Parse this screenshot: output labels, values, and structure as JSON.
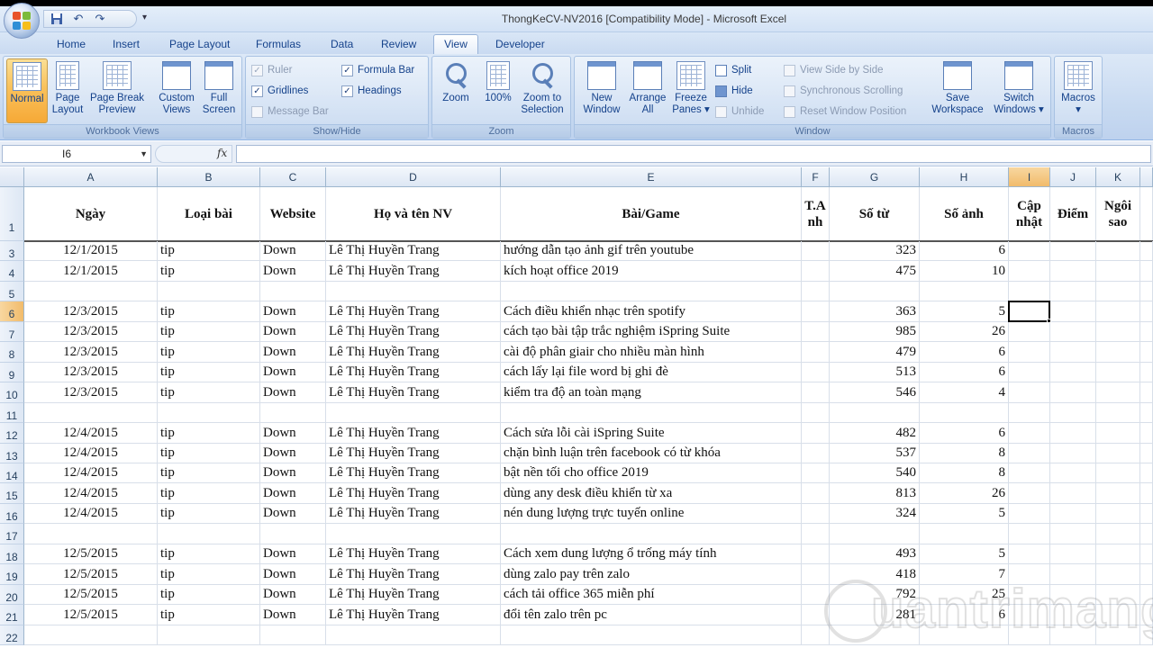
{
  "window": {
    "title": "ThongKeCV-NV2016  [Compatibility Mode] - Microsoft Excel"
  },
  "ribbon_tabs": [
    {
      "label": "Home",
      "active": false
    },
    {
      "label": "Insert",
      "active": false
    },
    {
      "label": "Page Layout",
      "active": false
    },
    {
      "label": "Formulas",
      "active": false
    },
    {
      "label": "Data",
      "active": false
    },
    {
      "label": "Review",
      "active": false
    },
    {
      "label": "View",
      "active": true
    },
    {
      "label": "Developer",
      "active": false
    }
  ],
  "ribbon": {
    "workbook_views": {
      "label": "Workbook Views",
      "normal": "Normal",
      "page_layout_1": "Page",
      "page_layout_2": "Layout",
      "page_break_1": "Page Break",
      "page_break_2": "Preview",
      "custom_views_1": "Custom",
      "custom_views_2": "Views",
      "full_screen_1": "Full",
      "full_screen_2": "Screen"
    },
    "show_hide": {
      "label": "Show/Hide",
      "ruler": "Ruler",
      "formula_bar": "Formula Bar",
      "gridlines": "Gridlines",
      "headings": "Headings",
      "message_bar": "Message Bar"
    },
    "zoom": {
      "label": "Zoom",
      "zoom": "Zoom",
      "hundred": "100%",
      "zoom_selection_1": "Zoom to",
      "zoom_selection_2": "Selection"
    },
    "window": {
      "label": "Window",
      "new_window_1": "New",
      "new_window_2": "Window",
      "arrange_all_1": "Arrange",
      "arrange_all_2": "All",
      "freeze_panes_1": "Freeze",
      "freeze_panes_2": "Panes ▾",
      "split": "Split",
      "hide": "Hide",
      "unhide": "Unhide",
      "view_side_by_side": "View Side by Side",
      "sync_scrolling": "Synchronous Scrolling",
      "reset_position": "Reset Window Position",
      "save_workspace_1": "Save",
      "save_workspace_2": "Workspace",
      "switch_windows_1": "Switch",
      "switch_windows_2": "Windows ▾"
    },
    "macros": {
      "label": "Macros",
      "macros": "Macros",
      "arrow": "▾"
    }
  },
  "formula_bar": {
    "name_box": "I6",
    "fx": "fx",
    "content": ""
  },
  "columns": [
    "A",
    "B",
    "C",
    "D",
    "E",
    "F",
    "G",
    "H",
    "I",
    "J",
    "K"
  ],
  "selected_column": "I",
  "selected_row": "6",
  "header_row": {
    "row_number": "1",
    "cells": [
      "Ngày",
      "Loại bài",
      "Website",
      "Họ và tên NV",
      "Bài/Game",
      "T.A nh",
      "Số từ",
      "Số ảnh",
      "Cập nhật",
      "Điểm",
      "Ngôi sao"
    ]
  },
  "rows": [
    {
      "n": "3",
      "date": "12/1/2015",
      "type": "tip",
      "site": "Down",
      "name": "Lê Thị Huyền Trang",
      "title": "hướng dẫn tạo ảnh gif trên youtube",
      "words": "323",
      "images": "6"
    },
    {
      "n": "4",
      "date": "12/1/2015",
      "type": "tip",
      "site": "Down",
      "name": "Lê Thị Huyền Trang",
      "title": "kích hoạt office 2019",
      "words": "475",
      "images": "10"
    },
    {
      "n": "5",
      "date": "",
      "type": "",
      "site": "",
      "name": "",
      "title": "",
      "words": "",
      "images": ""
    },
    {
      "n": "6",
      "date": "12/3/2015",
      "type": "tip",
      "site": "Down",
      "name": "Lê Thị Huyền Trang",
      "title": "Cách điều khiển nhạc trên spotify",
      "words": "363",
      "images": "5"
    },
    {
      "n": "7",
      "date": "12/3/2015",
      "type": "tip",
      "site": "Down",
      "name": "Lê Thị Huyền Trang",
      "title": "cách tạo bài tập trắc nghiệm iSpring Suite",
      "words": "985",
      "images": "26"
    },
    {
      "n": "8",
      "date": "12/3/2015",
      "type": "tip",
      "site": "Down",
      "name": "Lê Thị Huyền Trang",
      "title": "cài độ phân giair cho nhiều màn hình",
      "words": "479",
      "images": "6"
    },
    {
      "n": "9",
      "date": "12/3/2015",
      "type": "tip",
      "site": "Down",
      "name": "Lê Thị Huyền Trang",
      "title": "cách lấy lại file word bị ghi đè",
      "words": "513",
      "images": "6"
    },
    {
      "n": "10",
      "date": "12/3/2015",
      "type": "tip",
      "site": "Down",
      "name": "Lê Thị Huyền Trang",
      "title": "kiểm tra độ an toàn mạng",
      "words": "546",
      "images": "4"
    },
    {
      "n": "11",
      "date": "",
      "type": "",
      "site": "",
      "name": "",
      "title": "",
      "words": "",
      "images": ""
    },
    {
      "n": "12",
      "date": "12/4/2015",
      "type": "tip",
      "site": "Down",
      "name": "Lê Thị Huyền Trang",
      "title": "Cách sửa lỗi cài iSpring Suite",
      "words": "482",
      "images": "6"
    },
    {
      "n": "13",
      "date": "12/4/2015",
      "type": "tip",
      "site": "Down",
      "name": "Lê Thị Huyền Trang",
      "title": "chặn bình luận trên facebook có từ khóa",
      "words": "537",
      "images": "8"
    },
    {
      "n": "14",
      "date": "12/4/2015",
      "type": "tip",
      "site": "Down",
      "name": "Lê Thị Huyền Trang",
      "title": "bật nền tối cho office 2019",
      "words": "540",
      "images": "8"
    },
    {
      "n": "15",
      "date": "12/4/2015",
      "type": "tip",
      "site": "Down",
      "name": "Lê Thị Huyền Trang",
      "title": "dùng any desk điều khiển từ xa",
      "words": "813",
      "images": "26"
    },
    {
      "n": "16",
      "date": "12/4/2015",
      "type": "tip",
      "site": "Down",
      "name": "Lê Thị Huyền Trang",
      "title": "nén dung lượng trực tuyến online",
      "words": "324",
      "images": "5"
    },
    {
      "n": "17",
      "date": "",
      "type": "",
      "site": "",
      "name": "",
      "title": "",
      "words": "",
      "images": ""
    },
    {
      "n": "18",
      "date": "12/5/2015",
      "type": "tip",
      "site": "Down",
      "name": "Lê Thị Huyền Trang",
      "title": "Cách xem dung lượng ổ trống máy tính",
      "words": "493",
      "images": "5"
    },
    {
      "n": "19",
      "date": "12/5/2015",
      "type": "tip",
      "site": "Down",
      "name": "Lê Thị Huyền Trang",
      "title": "dùng zalo pay trên zalo",
      "words": "418",
      "images": "7"
    },
    {
      "n": "20",
      "date": "12/5/2015",
      "type": "tip",
      "site": "Down",
      "name": "Lê Thị Huyền Trang",
      "title": "cách tải office 365 miễn phí",
      "words": "792",
      "images": "25"
    },
    {
      "n": "21",
      "date": "12/5/2015",
      "type": "tip",
      "site": "Down",
      "name": "Lê Thị Huyền Trang",
      "title": "đổi tên zalo trên pc",
      "words": "281",
      "images": "6"
    },
    {
      "n": "22",
      "date": "",
      "type": "",
      "site": "",
      "name": "",
      "title": "",
      "words": "",
      "images": ""
    }
  ],
  "watermark": "uantrimang",
  "colors": {
    "accent": "#15428b",
    "active_button": "#f9c15b",
    "selected_header": "#f1bb6b"
  }
}
